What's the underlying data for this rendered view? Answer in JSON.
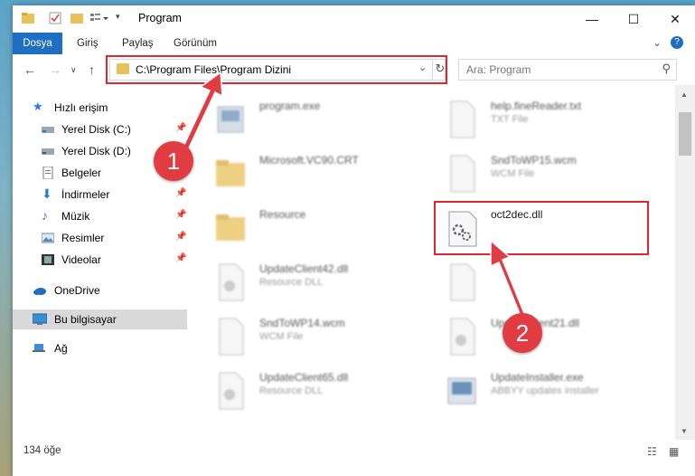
{
  "window": {
    "title": "Program"
  },
  "ribbon": {
    "tabs": [
      "Dosya",
      "Giriş",
      "Paylaş",
      "Görünüm"
    ]
  },
  "address": {
    "path": "C:\\Program Files\\Program Dizini",
    "search_placeholder": "Ara: Program"
  },
  "nav": {
    "quick_access": "Hızlı erişim",
    "items": [
      "Yerel Disk (C:)",
      "Yerel Disk (D:)",
      "Belgeler",
      "İndirmeler",
      "Müzik",
      "Resimler",
      "Videolar"
    ],
    "onedrive": "OneDrive",
    "this_pc": "Bu bilgisayar",
    "network": "Ağ"
  },
  "files": [
    {
      "name": "program.exe",
      "type": ""
    },
    {
      "name": "help.fineReader.txt",
      "type": "TXT File"
    },
    {
      "name": "Microsoft.VC90.CRT",
      "type": ""
    },
    {
      "name": "SndToWP15.wcm",
      "type": "WCM File"
    },
    {
      "name": "Resource",
      "type": ""
    },
    {
      "name": "oct2dec.dll",
      "type": ""
    },
    {
      "name": "UpdateClient42.dll",
      "type": "Resource DLL"
    },
    {
      "name": "",
      "type": ""
    },
    {
      "name": "SndToWP14.wcm",
      "type": "WCM File"
    },
    {
      "name": "UpdateClient21.dll",
      "type": ""
    },
    {
      "name": "UpdateClient65.dll",
      "type": "Resource DLL"
    },
    {
      "name": "UpdateInstaller.exe",
      "type": "ABBYY updates installer"
    }
  ],
  "status": {
    "count": "134 öğe"
  },
  "callouts": [
    "1",
    "2"
  ],
  "colors": {
    "accent": "#1e6fc4",
    "highlight": "#e0262f",
    "callout": "#e23c43"
  }
}
